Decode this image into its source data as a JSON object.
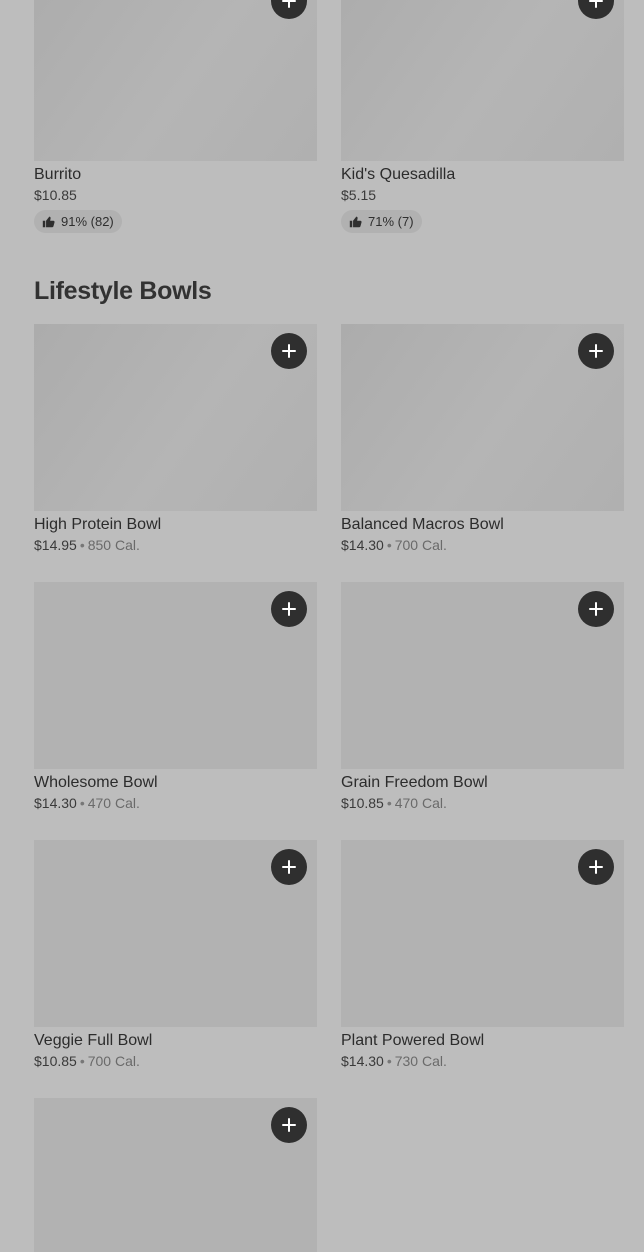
{
  "top_items": [
    {
      "name": "Burrito",
      "price": "$10.85",
      "rating": "91% (82)"
    },
    {
      "name": "Kid's Quesadilla",
      "price": "$5.15",
      "rating": "71% (7)"
    }
  ],
  "section": {
    "title": "Lifestyle Bowls"
  },
  "bowls": [
    {
      "name": "High Protein Bowl",
      "price": "$14.95",
      "separator": "•",
      "calories": "850 Cal."
    },
    {
      "name": "Balanced Macros Bowl",
      "price": "$14.30",
      "separator": "•",
      "calories": "700 Cal."
    },
    {
      "name": "Wholesome Bowl",
      "price": "$14.30",
      "separator": "•",
      "calories": "470 Cal."
    },
    {
      "name": "Grain Freedom Bowl",
      "price": "$10.85",
      "separator": "•",
      "calories": "470 Cal."
    },
    {
      "name": "Veggie Full Bowl",
      "price": "$10.85",
      "separator": "•",
      "calories": "700 Cal."
    },
    {
      "name": "Plant Powered Bowl",
      "price": "$14.30",
      "separator": "•",
      "calories": "730 Cal."
    }
  ],
  "icons": {
    "add": "plus-icon",
    "rating": "thumbs-up-icon"
  },
  "colors": {
    "background": "#bdbdbd",
    "tile": "#b2b2b2",
    "button": "#2f2f2f"
  }
}
